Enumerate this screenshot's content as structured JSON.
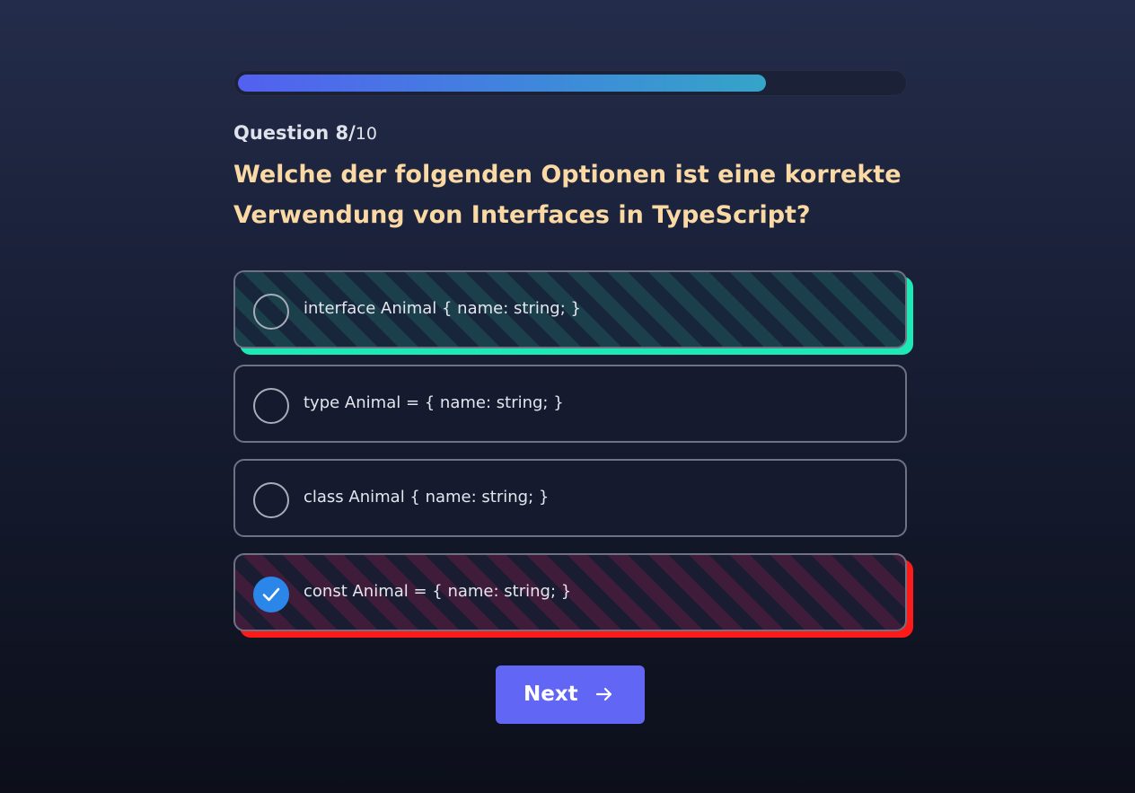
{
  "progress": {
    "fraction": 0.795
  },
  "question": {
    "counter_current": "Question 8/",
    "counter_total": "10",
    "text": "Welche der folgenden Optionen ist eine korrekte Verwendung von Interfaces in TypeScript?"
  },
  "options": [
    {
      "label": "interface Animal { name: string; }",
      "state": "correct",
      "selected": false
    },
    {
      "label": "type Animal = { name: string; }",
      "state": "neutral",
      "selected": false
    },
    {
      "label": "class Animal { name: string; }",
      "state": "neutral",
      "selected": false
    },
    {
      "label": "const Animal = { name: string; }",
      "state": "wrong",
      "selected": true
    }
  ],
  "next_button": {
    "label": "Next",
    "icon": "arrow-right-icon"
  },
  "colors": {
    "accent": "#6266f5",
    "correct": "#1de9b6",
    "wrong": "#ff1a1a",
    "question": "#fbd9a5",
    "check": "#2a86e8"
  }
}
